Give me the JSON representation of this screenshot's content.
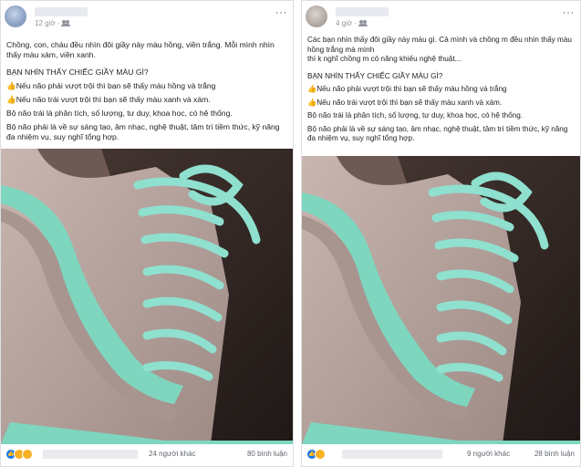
{
  "post1": {
    "time": "12 giờ ·",
    "privacy_icon": "friends-icon",
    "text": {
      "intro": "Chồng, con, cháu đều nhìn đôi giầy này màu hồng, viền trắng. Mỗi mình nhìn thấy màu xám, viền xanh.",
      "question": "BẠN NHÌN THẤY CHIẾC GIẦY MÀU GÌ?",
      "option1": "Nếu não phải vượt trội thì bạn sẽ thấy màu hồng và trắng",
      "option2": "Nếu não trái vượt trội thì bạn sẽ thấy màu xanh và xám.",
      "left_brain": "Bộ não trái là phân tích, số lượng, tư duy, khoa học, có hệ thống.",
      "right_brain": "Bộ não phải là về sự sáng tạo, âm nhạc, nghệ thuật, tâm trí tiềm thức, kỹ năng đa nhiệm vụ, suy nghĩ tổng hợp."
    },
    "others": "24 người khác",
    "comments": "80 bình luận"
  },
  "post2": {
    "time": "4 giờ ·",
    "privacy_icon": "friends-icon",
    "text": {
      "line1": "Các bạn nhìn thấy đôi giầy này màu gì. Cả mình và chồng m đều nhìn thấy màu hồng trắng mà mình",
      "line2": "thì k nghĩ chồng m có năng khiếu nghệ thuật...",
      "question": "BẠN NHÌN THẤY CHIẾC GIẦY MÀU GÌ?",
      "option1": "Nếu não phải vượt trội thì bạn sẽ thấy màu hồng và trắng",
      "option2": "Nếu não trái vượt trội thì bạn sẽ thấy màu xanh và xám.",
      "left_brain": "Bộ não trái là phân tích, số lượng, tư duy, khoa học, có hệ thống.",
      "right_brain": "Bộ não phải là về sự sáng tạo, âm nhạc, nghệ thuật, tâm trí tiềm thức, kỹ năng đa nhiệm vụ, suy nghĩ tổng hợp."
    },
    "others": "9 người khác",
    "comments": "28 bình luận"
  },
  "icons": {
    "more": "more-options-icon",
    "point": "pointing-hand-icon",
    "like": "like-reaction-icon",
    "wow": "wow-reaction-icon",
    "haha": "haha-reaction-icon"
  },
  "colors": {
    "shoe_body": "#b9a6a0",
    "shoe_stripe": "#7fd6bf",
    "laces": "#8fe0cf",
    "background": "#2b2320",
    "facebook_blue": "#1877f2"
  }
}
